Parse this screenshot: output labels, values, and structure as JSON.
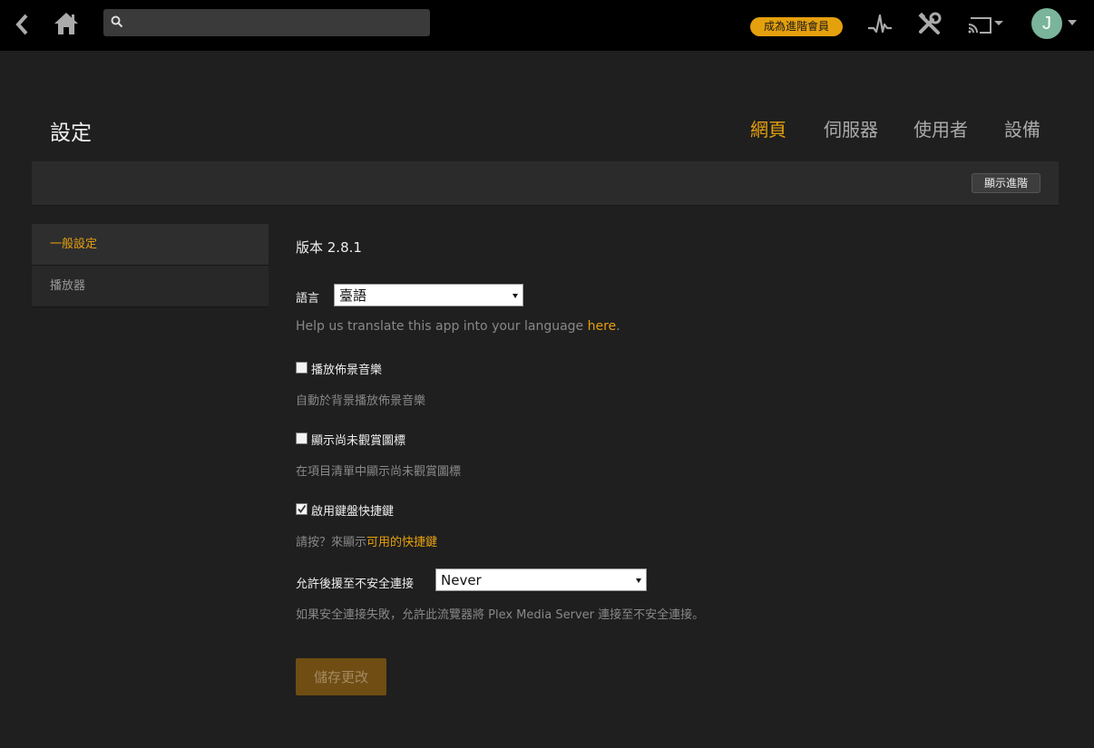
{
  "topbar": {
    "search_placeholder": "",
    "premium_label": "成為進階會員",
    "avatar_initial": "J"
  },
  "header": {
    "title": "設定",
    "tabs": [
      {
        "label": "網頁",
        "active": true
      },
      {
        "label": "伺服器",
        "active": false
      },
      {
        "label": "使用者",
        "active": false
      },
      {
        "label": "設備",
        "active": false
      }
    ],
    "advanced_label": "顯示進階"
  },
  "sidebar": {
    "items": [
      {
        "label": "一般設定",
        "active": true
      },
      {
        "label": "播放器",
        "active": false
      }
    ]
  },
  "main": {
    "version": "版本 2.8.1",
    "language": {
      "label": "語言",
      "value": "臺語",
      "help_prefix": "Help us translate this app into your language ",
      "help_link": "here",
      "help_suffix": "."
    },
    "background_music": {
      "label": "播放佈景音樂",
      "checked": false,
      "help": "自動於背景播放佈景音樂"
    },
    "unwatched_icon": {
      "label": "顯示尚未觀賞圖標",
      "checked": false,
      "help": "在項目清單中顯示尚未觀賞圖標"
    },
    "keyboard_shortcuts": {
      "label": "啟用鍵盤快捷鍵",
      "checked": true,
      "help_prefix": "請按？來顯示",
      "help_link": "可用的快捷鍵"
    },
    "insecure": {
      "label": "允許後援至不安全連接",
      "value": "Never",
      "help": "如果安全連接失敗，允許此流覽器將 Plex Media Server 連接至不安全連接。"
    },
    "save_label": "儲存更改"
  },
  "colors": {
    "accent": "#e5a00d",
    "background": "#1f1f1f",
    "topbar": "#000000",
    "avatar": "#7ab49a"
  }
}
